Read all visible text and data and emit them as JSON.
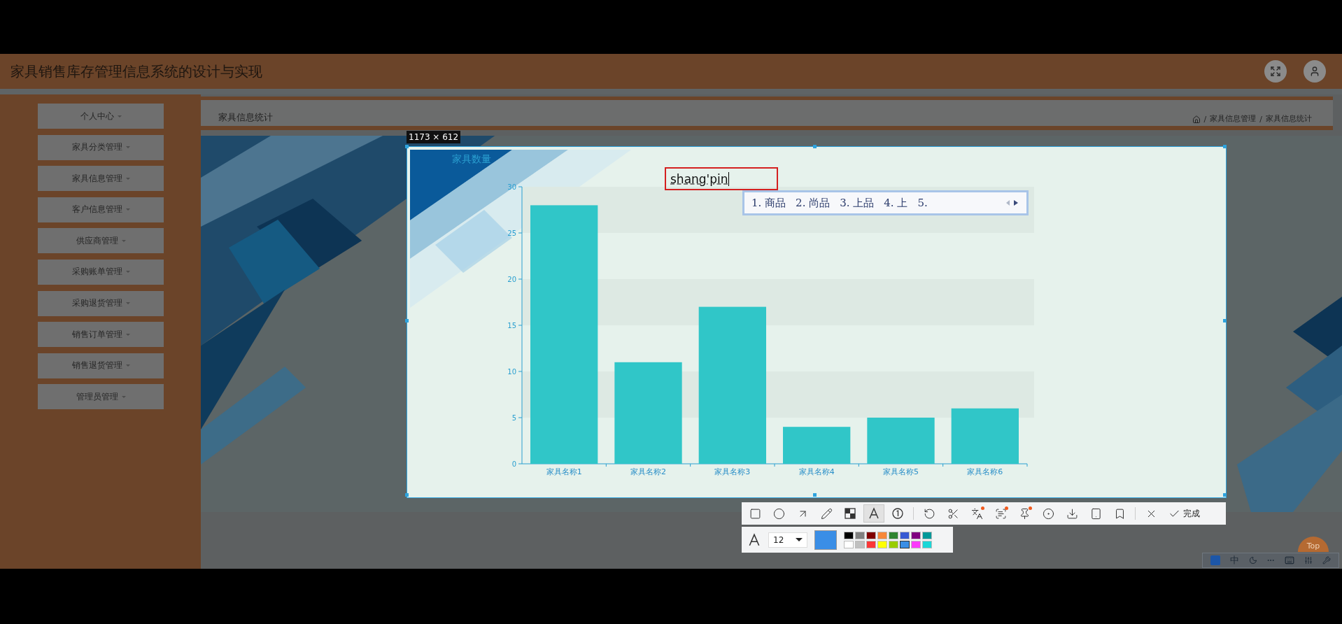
{
  "app": {
    "title": "家具销售库存管理信息系统的设计与实现"
  },
  "menu": [
    {
      "label": "个人中心"
    },
    {
      "label": "家具分类管理"
    },
    {
      "label": "家具信息管理"
    },
    {
      "label": "客户信息管理"
    },
    {
      "label": "供应商管理"
    },
    {
      "label": "采购账单管理"
    },
    {
      "label": "采购退货管理"
    },
    {
      "label": "销售订单管理"
    },
    {
      "label": "销售退货管理"
    },
    {
      "label": "管理员管理"
    }
  ],
  "page_title": "家具信息统计",
  "breadcrumb": {
    "separator": "/",
    "items": [
      "家具信息管理",
      "家具信息统计"
    ]
  },
  "capture": {
    "size_label": "1173 × 612"
  },
  "chart": {
    "chart_data": {
      "type": "bar",
      "title": "家具数量",
      "categories": [
        "家具名称1",
        "家具名称2",
        "家具名称3",
        "家具名称4",
        "家具名称5",
        "家具名称6"
      ],
      "values": [
        28,
        11,
        17,
        4,
        5,
        6
      ],
      "ylim": [
        0,
        30
      ],
      "yticks": [
        0,
        5,
        10,
        15,
        20,
        25,
        30
      ]
    }
  },
  "text_input": {
    "value": "shang'pin"
  },
  "ime": {
    "candidates": [
      "1. 商品",
      "2. 尚品",
      "3. 上品",
      "4. 上",
      "5."
    ]
  },
  "toolbar": {
    "done_label": "完成",
    "tools": [
      {
        "kind": "rect",
        "selected": false,
        "badge": false
      },
      {
        "kind": "ellipse",
        "selected": false,
        "badge": false
      },
      {
        "kind": "arrow",
        "selected": false,
        "badge": false
      },
      {
        "kind": "pencil",
        "selected": false,
        "badge": false
      },
      {
        "kind": "mosaic",
        "selected": false,
        "badge": false
      },
      {
        "kind": "text",
        "selected": true,
        "badge": false
      },
      {
        "kind": "number",
        "selected": false,
        "badge": false
      },
      {
        "kind": "undo",
        "selected": false,
        "badge": false
      },
      {
        "kind": "cut",
        "selected": false,
        "badge": false
      },
      {
        "kind": "translate",
        "selected": false,
        "badge": true
      },
      {
        "kind": "ocr",
        "selected": false,
        "badge": true
      },
      {
        "kind": "pin",
        "selected": false,
        "badge": true
      },
      {
        "kind": "record",
        "selected": false,
        "badge": false
      },
      {
        "kind": "download",
        "selected": false,
        "badge": false
      },
      {
        "kind": "tablet",
        "selected": false,
        "badge": false
      },
      {
        "kind": "bookmark",
        "selected": false,
        "badge": false
      },
      {
        "kind": "close",
        "selected": false,
        "badge": false
      }
    ]
  },
  "style_bar": {
    "font_size": "12",
    "palette": [
      {
        "color": "#000000",
        "selected": false
      },
      {
        "color": "#808080",
        "selected": false
      },
      {
        "color": "#800000",
        "selected": false
      },
      {
        "color": "#f7883a",
        "selected": false
      },
      {
        "color": "#308430",
        "selected": false
      },
      {
        "color": "#385ad3",
        "selected": false
      },
      {
        "color": "#800080",
        "selected": false
      },
      {
        "color": "#009999",
        "selected": false
      },
      {
        "color": "#ffffff",
        "selected": false
      },
      {
        "color": "#c0c0c0",
        "selected": false
      },
      {
        "color": "#fb3838",
        "selected": false
      },
      {
        "color": "#ffff00",
        "selected": false
      },
      {
        "color": "#99cc00",
        "selected": false
      },
      {
        "color": "#3a8ee6",
        "selected": true
      },
      {
        "color": "#fb3bfb",
        "selected": false
      },
      {
        "color": "#1ad7d7",
        "selected": false
      }
    ]
  },
  "top_button": {
    "label": "Top"
  },
  "ime_status": {
    "mode": "中"
  }
}
